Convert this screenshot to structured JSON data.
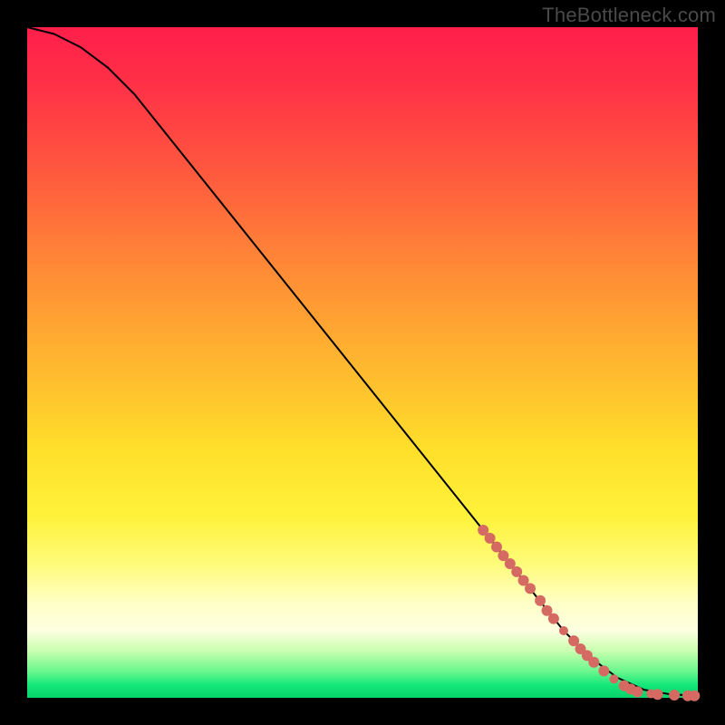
{
  "watermark": "TheBottleneck.com",
  "colors": {
    "dot": "#d46a62",
    "curve": "#000000",
    "frame_bg": "#000000"
  },
  "chart_data": {
    "type": "line",
    "title": "",
    "xlabel": "",
    "ylabel": "",
    "xlim": [
      0,
      100
    ],
    "ylim": [
      0,
      100
    ],
    "grid": false,
    "legend": false,
    "series": [
      {
        "name": "bottleneck-curve",
        "x": [
          0,
          4,
          8,
          12,
          16,
          20,
          24,
          28,
          32,
          36,
          40,
          44,
          48,
          52,
          56,
          60,
          64,
          68,
          72,
          76,
          80,
          84,
          88,
          92,
          96,
          100
        ],
        "y": [
          100,
          99,
          97,
          94,
          90,
          85,
          80,
          75,
          70,
          65,
          60,
          55,
          50,
          45,
          40,
          35,
          30,
          25,
          20,
          15,
          10,
          6,
          3,
          1.2,
          0.5,
          0.3
        ]
      }
    ],
    "scatter": {
      "name": "highlighted-points",
      "points": [
        {
          "x": 68,
          "y": 25.0,
          "r": 6
        },
        {
          "x": 69,
          "y": 23.8,
          "r": 6
        },
        {
          "x": 70,
          "y": 22.5,
          "r": 6
        },
        {
          "x": 71,
          "y": 21.2,
          "r": 6
        },
        {
          "x": 72,
          "y": 20.0,
          "r": 6
        },
        {
          "x": 73,
          "y": 18.8,
          "r": 6
        },
        {
          "x": 74,
          "y": 17.5,
          "r": 6
        },
        {
          "x": 75,
          "y": 16.3,
          "r": 6
        },
        {
          "x": 76.5,
          "y": 14.5,
          "r": 6
        },
        {
          "x": 77.5,
          "y": 13.0,
          "r": 6
        },
        {
          "x": 78.5,
          "y": 11.8,
          "r": 6
        },
        {
          "x": 80.0,
          "y": 10.0,
          "r": 5
        },
        {
          "x": 81.5,
          "y": 8.5,
          "r": 6
        },
        {
          "x": 82.5,
          "y": 7.3,
          "r": 6
        },
        {
          "x": 83.5,
          "y": 6.3,
          "r": 6
        },
        {
          "x": 84.5,
          "y": 5.3,
          "r": 6
        },
        {
          "x": 86.0,
          "y": 4.0,
          "r": 6
        },
        {
          "x": 87.5,
          "y": 2.8,
          "r": 5
        },
        {
          "x": 89.0,
          "y": 1.8,
          "r": 6
        },
        {
          "x": 90.0,
          "y": 1.3,
          "r": 6
        },
        {
          "x": 91.0,
          "y": 0.9,
          "r": 6
        },
        {
          "x": 93.0,
          "y": 0.6,
          "r": 5
        },
        {
          "x": 94.0,
          "y": 0.5,
          "r": 6
        },
        {
          "x": 96.5,
          "y": 0.4,
          "r": 6
        },
        {
          "x": 98.5,
          "y": 0.3,
          "r": 6
        },
        {
          "x": 99.5,
          "y": 0.3,
          "r": 6
        }
      ]
    }
  }
}
